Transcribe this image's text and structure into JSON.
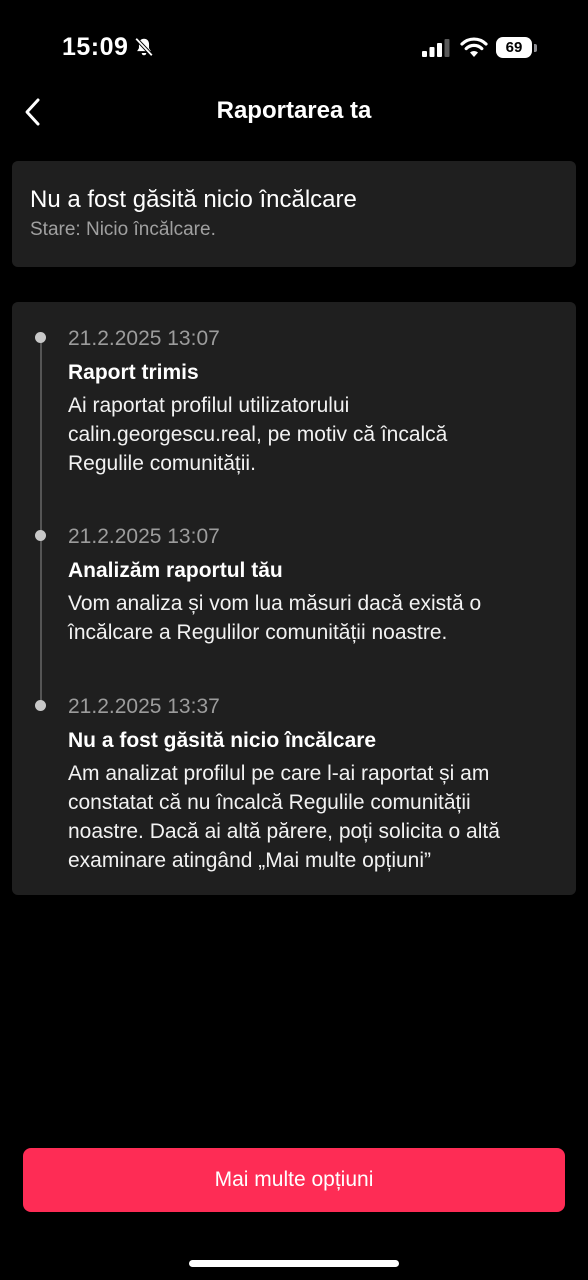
{
  "status_bar": {
    "time": "15:09",
    "battery": "69",
    "icons": [
      "bell-slash-icon",
      "cellular-signal-icon",
      "wifi-icon",
      "battery-icon"
    ]
  },
  "nav": {
    "title": "Raportarea ta",
    "back_icon": "chevron-left-icon"
  },
  "status_card": {
    "title": "Nu a fost găsită nicio încălcare",
    "subtitle": "Stare: Nicio încălcare."
  },
  "timeline": [
    {
      "date": "21.2.2025 13:07",
      "heading": "Raport trimis",
      "lines": [
        "Ai raportat profilul utilizatorului",
        "calin.georgescu.real, pe motiv că încalcă",
        "Regulile comunității."
      ]
    },
    {
      "date": "21.2.2025 13:07",
      "heading": "Analizăm raportul tău",
      "lines": [
        "Vom analiza și vom lua măsuri dacă există o",
        "încălcare a Regulilor comunității noastre."
      ]
    },
    {
      "date": "21.2.2025 13:37",
      "heading": "Nu a fost găsită nicio încălcare",
      "lines": [
        "Am analizat profilul pe care l-ai raportat și am",
        "constatat că nu încalcă Regulile comunității",
        "noastre. Dacă ai altă părere, poți solicita o altă",
        "examinare atingând „Mai multe opțiuni”"
      ]
    }
  ],
  "footer": {
    "more_options_label": "Mai multe opțiuni"
  },
  "colors": {
    "background": "#000000",
    "card": "#1f1f1f",
    "accent": "#fe2c55",
    "muted_text": "#9c9c9c"
  }
}
